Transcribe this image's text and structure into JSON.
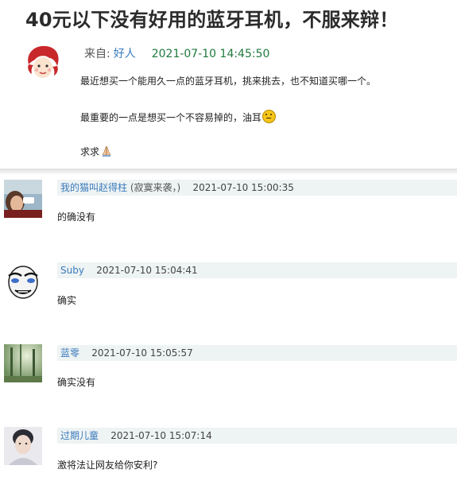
{
  "post": {
    "title": "40元以下没有好用的蓝牙耳机，不服来辩！",
    "from_label": "来自:",
    "author": "好人",
    "time": "2021-07-10 14:45:50",
    "lines": [
      "最近想买一个能用久一点的蓝牙耳机，挑来挑去，也不知道买哪一个。",
      "最重要的一点是想买一个不容易掉的，油耳",
      "求求"
    ],
    "emojis": [
      "smile-emoji-icon",
      "pray-emoji-icon"
    ]
  },
  "comments": [
    {
      "user": "我的猫叫赵得柱",
      "note": "(寂寞来袭，)",
      "time": "2021-07-10 15:00:35",
      "text": "的确没有"
    },
    {
      "user": "Suby",
      "note": "",
      "time": "2021-07-10 15:04:41",
      "text": "确实"
    },
    {
      "user": "蓝零",
      "note": "",
      "time": "2021-07-10 15:05:57",
      "text": "确实没有"
    },
    {
      "user": "过期儿童",
      "note": "",
      "time": "2021-07-10 15:07:14",
      "text": "激将法让网友给你安利?"
    }
  ]
}
